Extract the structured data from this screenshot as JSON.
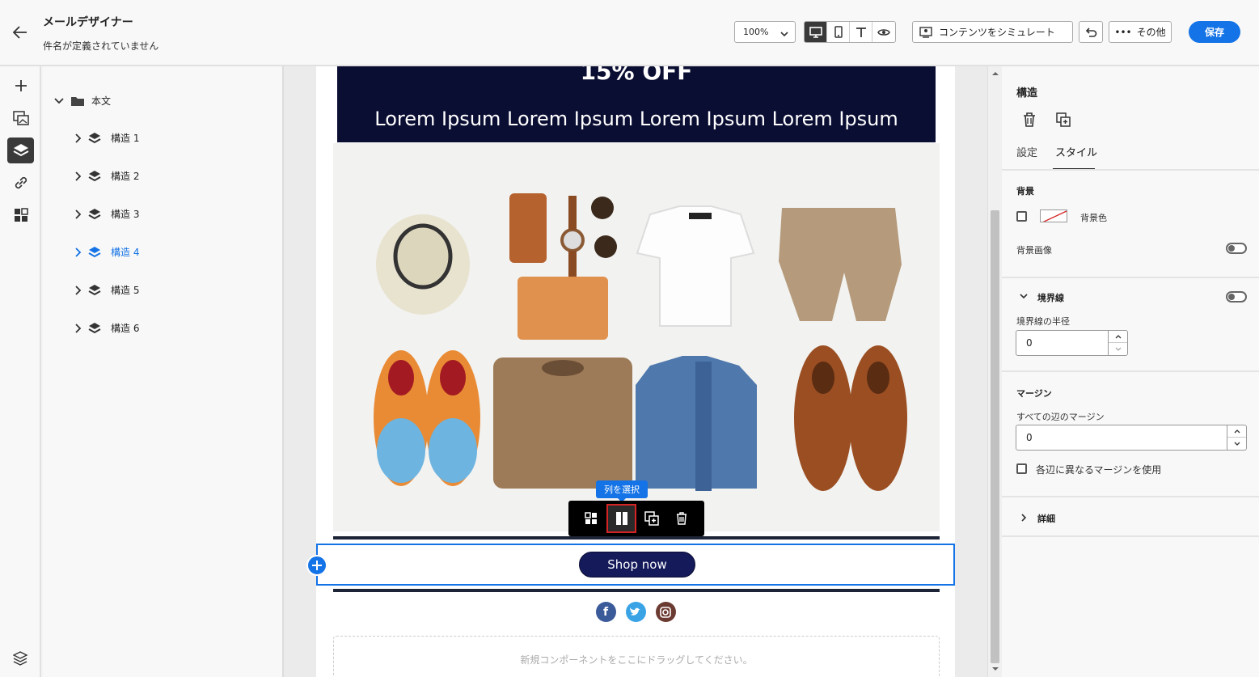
{
  "header": {
    "title": "メールデザイナー",
    "subtitle": "件名が定義されていません",
    "zoom": "100%",
    "simulate_label": "コンテンツをシミュレート",
    "more_label": "その他",
    "save_label": "保存"
  },
  "tree": {
    "root_label": "本文",
    "items": [
      {
        "label": "構造 1"
      },
      {
        "label": "構造 2"
      },
      {
        "label": "構造 3"
      },
      {
        "label": "構造 4"
      },
      {
        "label": "構造 5"
      },
      {
        "label": "構造 6"
      }
    ],
    "selected_index": 3
  },
  "email": {
    "discount": "15% OFF",
    "lorem": "Lorem Ipsum Lorem Ipsum Lorem Ipsum Lorem Ipsum",
    "shop_label": "Shop now",
    "dropzone_text": "新規コンポーネントをここにドラッグしてください。",
    "social_icons": [
      "facebook-icon",
      "twitter-icon",
      "instagram-icon"
    ]
  },
  "context_toolbar": {
    "tooltip": "列を選択"
  },
  "panel": {
    "title": "構造",
    "tabs": [
      "設定",
      "スタイル"
    ],
    "active_tab": "スタイル",
    "background_heading": "背景",
    "background_color_label": "背景色",
    "background_image_label": "背景画像",
    "border_heading": "境界線",
    "border_radius_label": "境界線の半径",
    "border_radius_value": "0",
    "margin_heading": "マージン",
    "margin_all_label": "すべての辺のマージン",
    "margin_all_value": "0",
    "margin_per_side_label": "各辺に異なるマージンを使用",
    "details_heading": "詳細"
  },
  "colors": {
    "accent": "#1473e6",
    "hero_band": "#0b0e33",
    "shop_button": "#141a5a",
    "selection_outline": "#d62424"
  }
}
